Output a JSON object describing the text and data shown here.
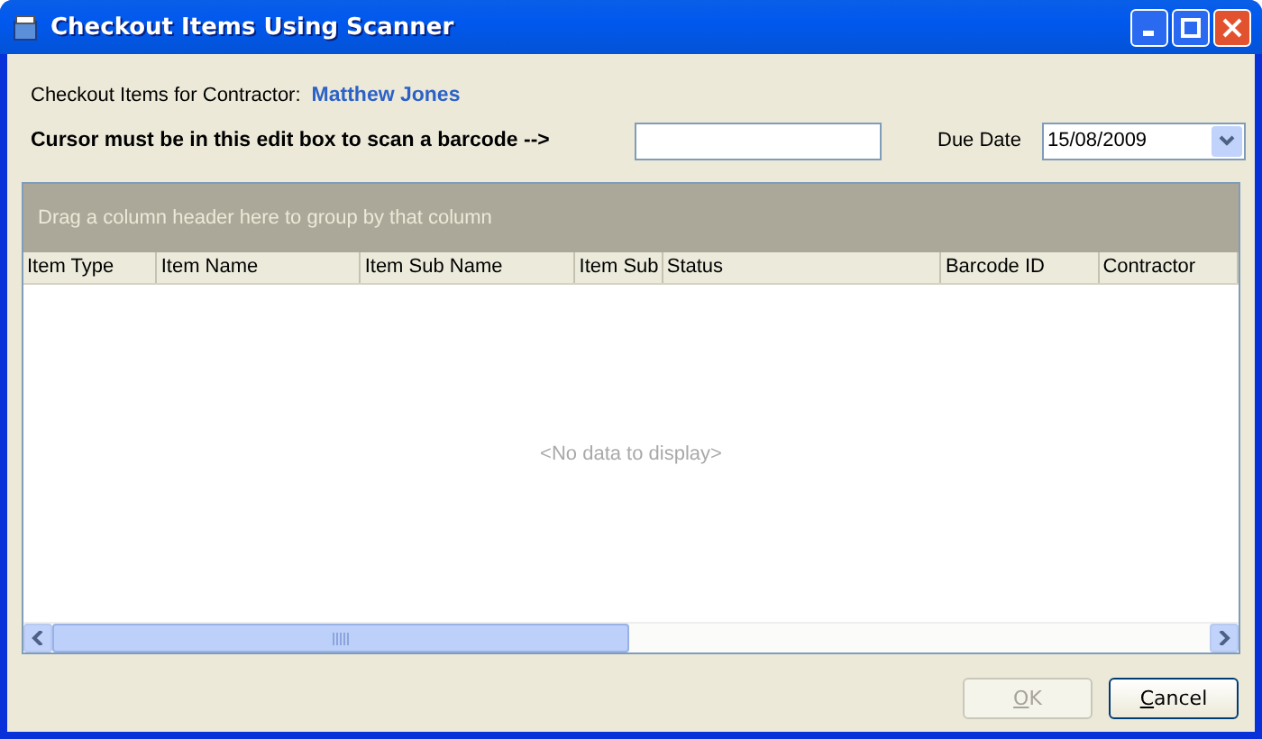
{
  "window": {
    "title": "Checkout Items Using Scanner"
  },
  "contractor": {
    "label": "Checkout Items for Contractor:",
    "name": "Matthew Jones"
  },
  "scan": {
    "label": "Cursor must be in this edit box to scan a barcode -->"
  },
  "due_date": {
    "label": "Due Date",
    "value": "15/08/2009"
  },
  "grid": {
    "group_hint": "Drag a column header here to group by that column",
    "columns": [
      "Item Type",
      "Item Name",
      "Item Sub Name",
      "Item Sub",
      "Status",
      "Barcode ID",
      "Contractor"
    ],
    "empty_text": "<No data to display>"
  },
  "buttons": [
    {
      "label": "OK",
      "disabled": true
    },
    {
      "label": "Cancel",
      "disabled": false
    }
  ]
}
